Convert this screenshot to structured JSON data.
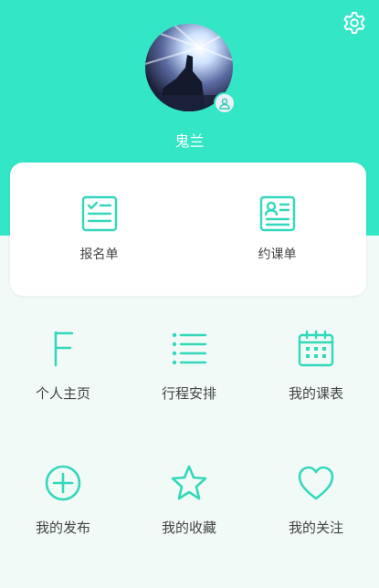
{
  "profile": {
    "username": "鬼兰"
  },
  "header": {
    "settings_icon": "gear-icon",
    "accent_color": "#33e6c6"
  },
  "card": {
    "items": [
      {
        "label": "报名单",
        "icon": "form-checklist-icon"
      },
      {
        "label": "约课单",
        "icon": "profile-document-icon"
      }
    ]
  },
  "grid": {
    "items": [
      {
        "label": "个人主页",
        "icon": "letter-f-icon"
      },
      {
        "label": "行程安排",
        "icon": "list-icon"
      },
      {
        "label": "我的课表",
        "icon": "calendar-icon"
      },
      {
        "label": "我的发布",
        "icon": "plus-circle-icon"
      },
      {
        "label": "我的收藏",
        "icon": "star-icon"
      },
      {
        "label": "我的关注",
        "icon": "heart-icon"
      }
    ]
  }
}
